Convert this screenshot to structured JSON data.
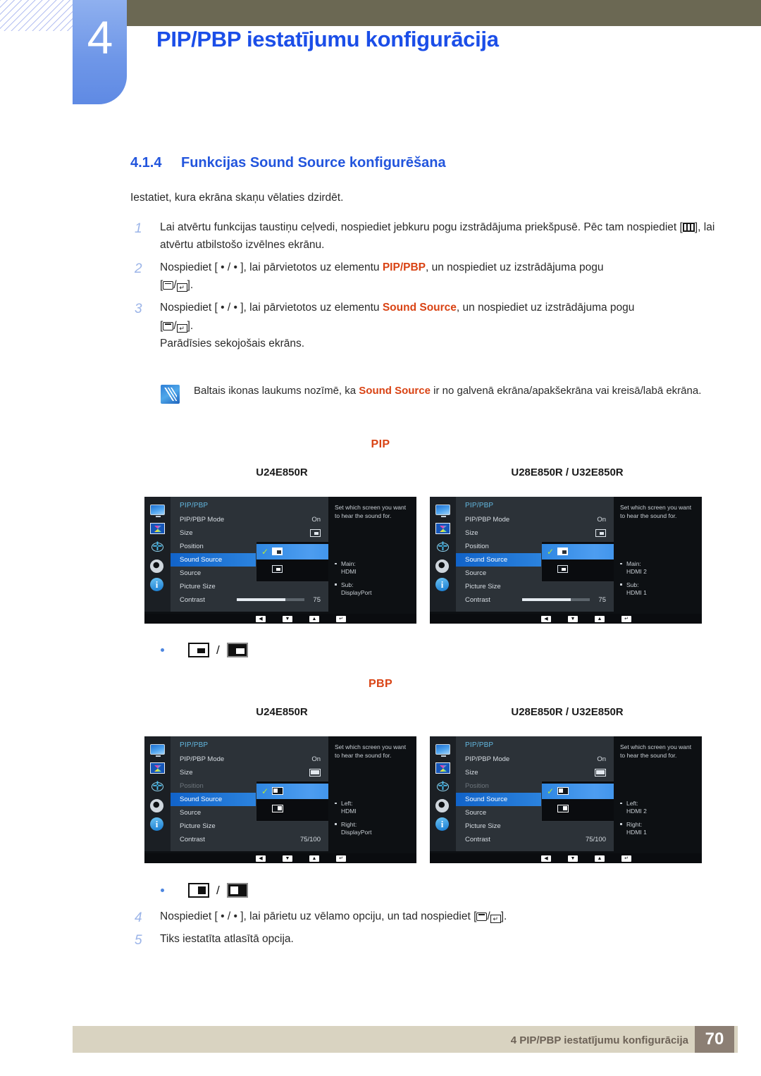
{
  "header": {
    "chapter_number": "4",
    "chapter_title": "PIP/PBP iestatījumu konfigurācija"
  },
  "section": {
    "number": "4.1.4",
    "title": "Funkcijas Sound Source konfigurēšana",
    "intro": "Iestatiet, kura ekrāna skaņu vēlaties dzirdēt."
  },
  "steps": [
    {
      "marker": "1",
      "text_a": "Lai atvērtu funkcijas taustiņu ceļvedi, nospiediet jebkuru pogu izstrādājuma priekšpusē. Pēc tam nospiediet [",
      "text_b": "], lai atvērtu atbilstošo izvēlnes ekrānu."
    },
    {
      "marker": "2",
      "text_a": "Nospiediet [ • / • ], lai pārvietotos uz elementu ",
      "keyword": "PIP/PBP",
      "text_b": ", un nospiediet uz izstrādājuma pogu"
    },
    {
      "marker": "3",
      "text_a": "Nospiediet [ • / • ], lai pārvietotos uz elementu ",
      "keyword": "Sound Source",
      "text_b": ", un nospiediet uz izstrādājuma pogu",
      "sub": "Parādīsies sekojošais ekrāns."
    },
    {
      "marker": "4",
      "text_a": "Nospiediet [ • / • ], lai pārietu uz vēlamo opciju, un tad nospiediet [",
      "text_b": "]."
    },
    {
      "marker": "5",
      "text_a": "Tiks iestatīta atlasītā opcija."
    }
  ],
  "note": {
    "text_a": "Baltais ikonas laukums nozīmē, ka ",
    "keyword": "Sound Source",
    "text_b": " ir no galvenā ekrāna/apakšekrāna vai kreisā/labā ekrāna."
  },
  "pip_section": {
    "mode_label": "PIP",
    "model_left": "U24E850R",
    "model_right": "U28E850R / U32E850R"
  },
  "pbp_section": {
    "mode_label": "PBP",
    "model_left": "U24E850R",
    "model_right": "U28E850R / U32E850R"
  },
  "osd": {
    "title": "PIP/PBP",
    "help_text": "Set which screen you want to hear the sound for.",
    "rows": {
      "mode": "PIP/PBP Mode",
      "mode_value": "On",
      "size": "Size",
      "position": "Position",
      "sound_source": "Sound Source",
      "source": "Source",
      "picture_size": "Picture Size",
      "contrast": "Contrast"
    },
    "pip_left": {
      "contrast_value": "75",
      "src1_label": "Main:",
      "src1_value": "HDMI",
      "src2_label": "Sub:",
      "src2_value": "DisplayPort"
    },
    "pip_right": {
      "contrast_value": "75",
      "src1_label": "Main:",
      "src1_value": "HDMI 2",
      "src2_label": "Sub:",
      "src2_value": "HDMI 1"
    },
    "pbp_left": {
      "contrast_value": "75/100",
      "src1_label": "Left:",
      "src1_value": "HDMI",
      "src2_label": "Right:",
      "src2_value": "DisplayPort"
    },
    "pbp_right": {
      "contrast_value": "75/100",
      "src1_label": "Left:",
      "src1_value": "HDMI 2",
      "src2_label": "Right:",
      "src2_value": "HDMI 1"
    },
    "nav": {
      "back": "◀",
      "down": "▼",
      "up": "▲",
      "enter": "↵"
    }
  },
  "footer": {
    "text": "4 PIP/PBP iestatījumu konfigurācija",
    "page": "70"
  },
  "colors": {
    "accent_blue": "#1b4ee8",
    "keyword_orange": "#d94314",
    "tab_blue": "#6f97e8",
    "olive": "#6b6853",
    "footer_bar": "#d9d3c1",
    "footer_page": "#8c7f74"
  }
}
